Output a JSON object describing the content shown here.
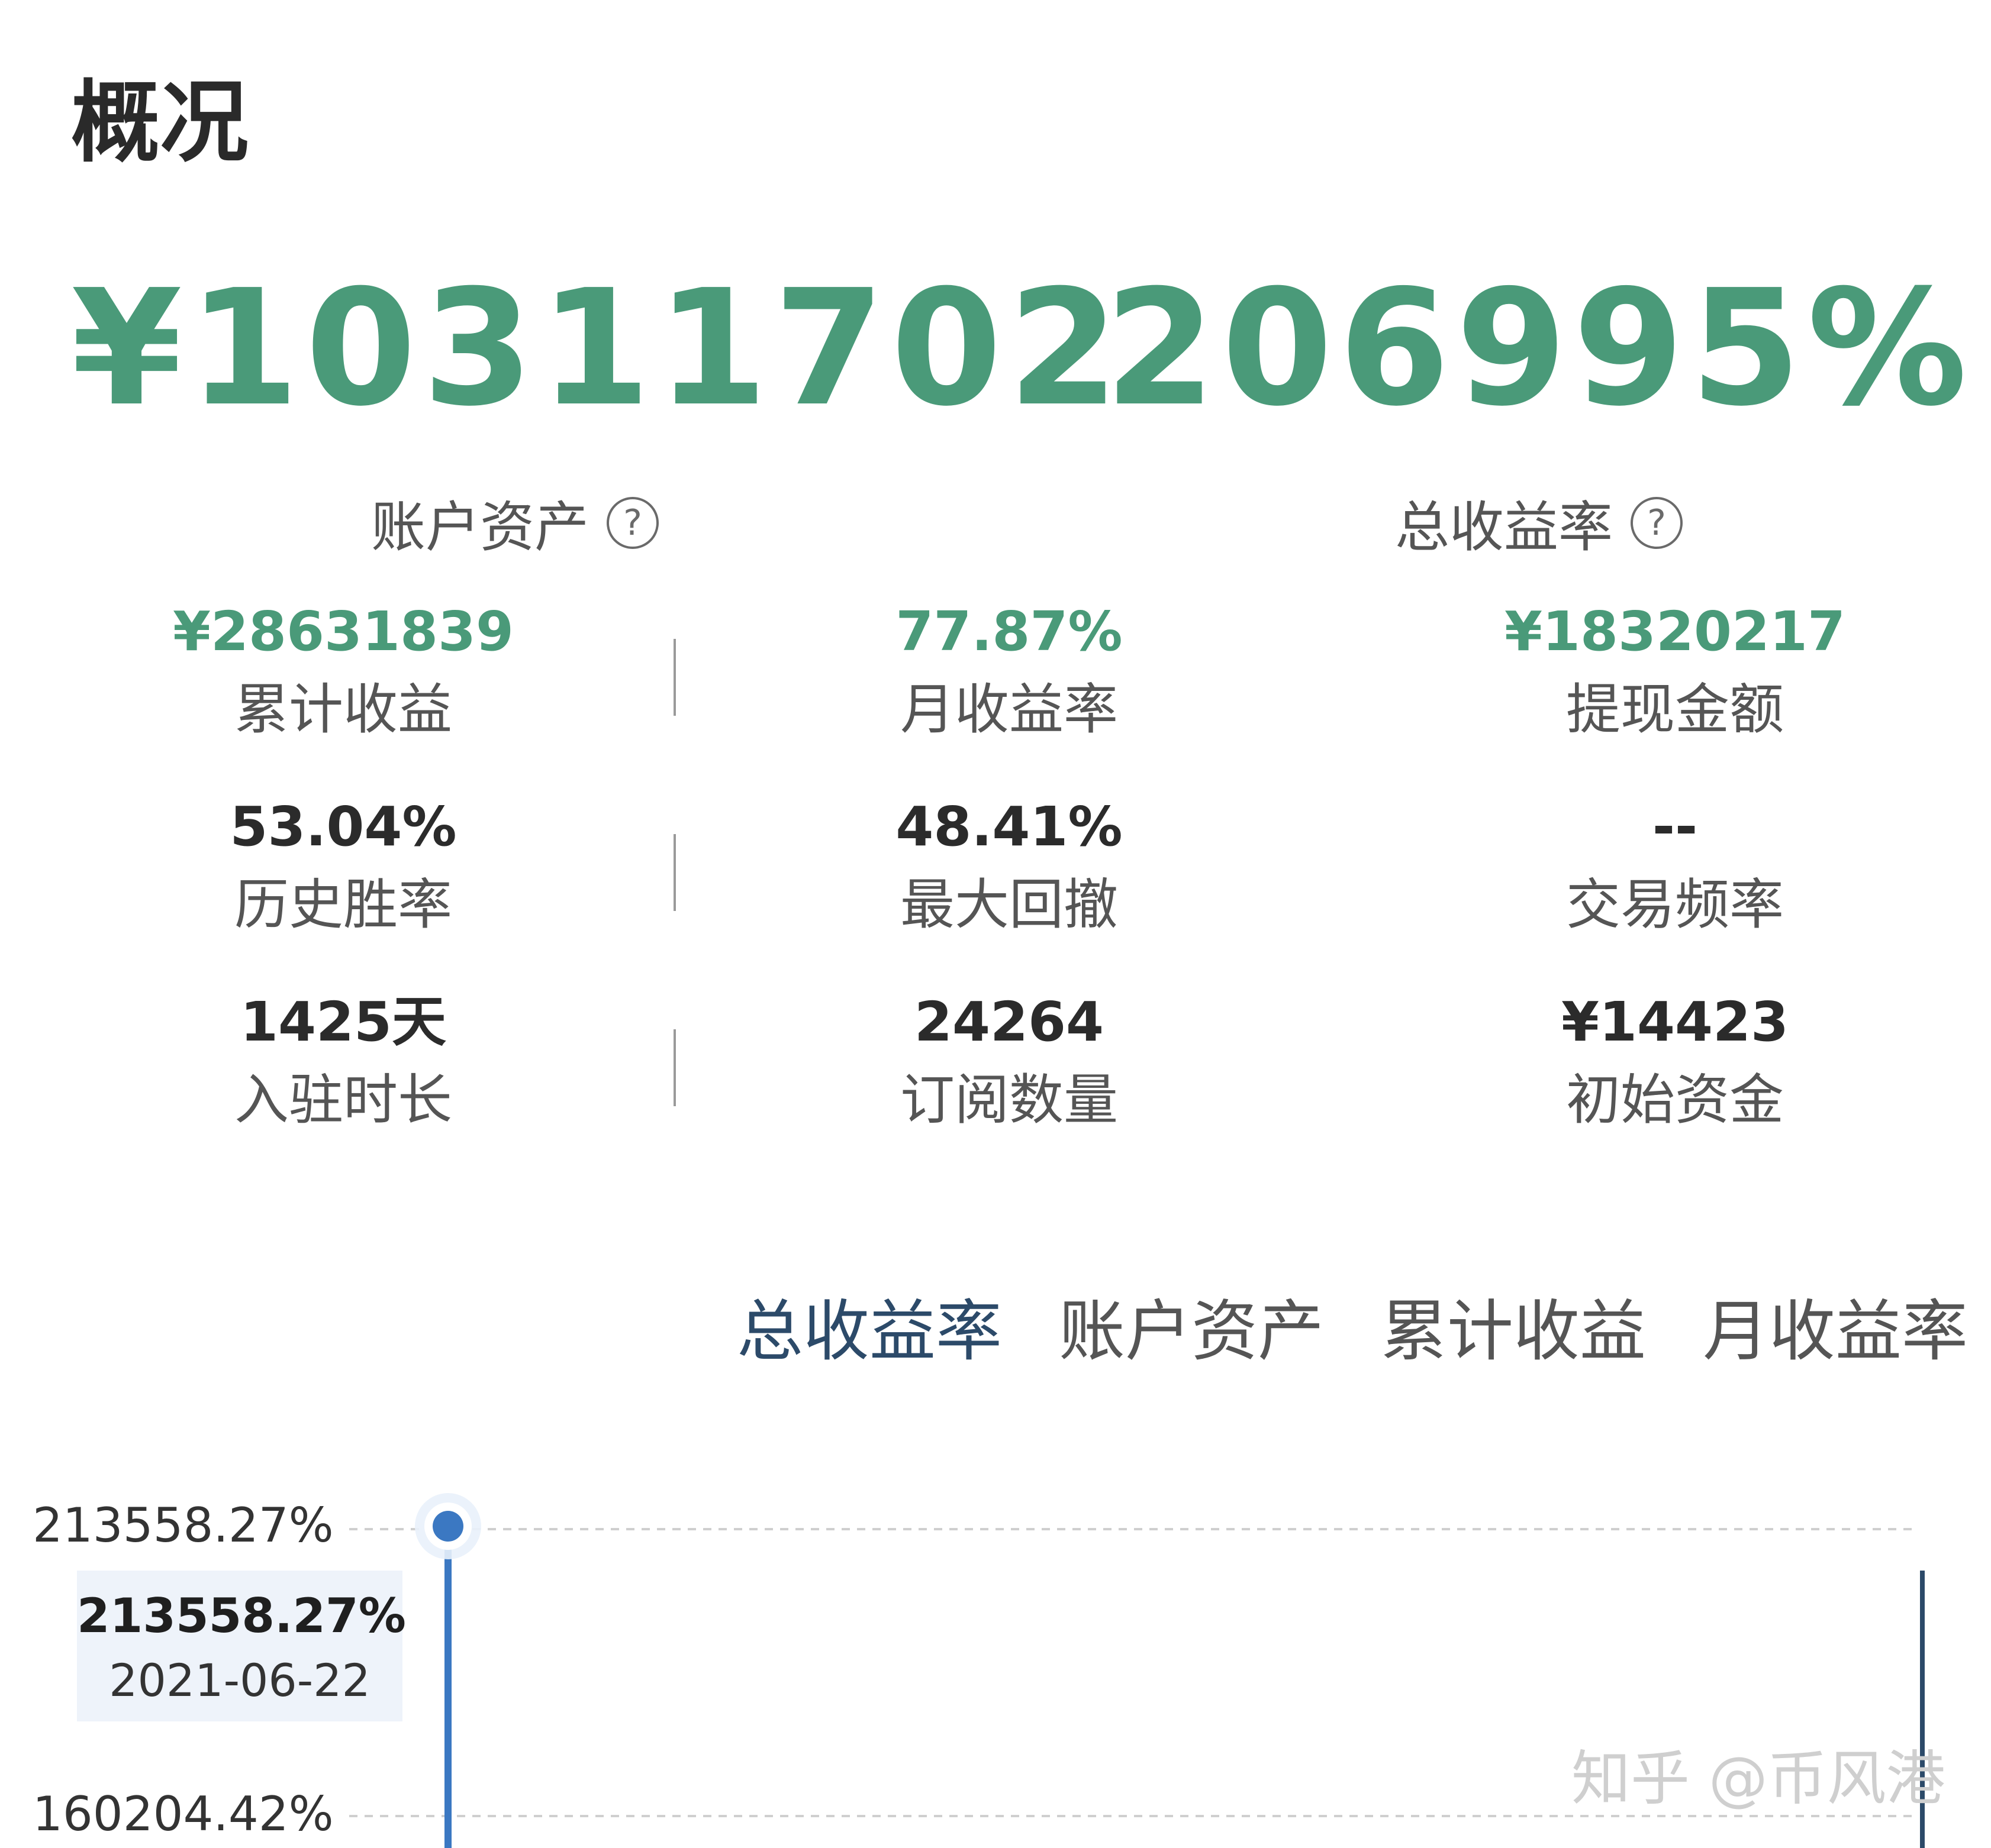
{
  "page": {
    "title": "概况"
  },
  "hero": {
    "account_assets": {
      "value": "¥10311702",
      "label": "账户资产"
    },
    "total_return": {
      "value": "206995%",
      "label": "总收益率"
    },
    "help_glyph": "?"
  },
  "stats": {
    "cumulative_profit": {
      "value": "¥28631839",
      "label": "累计收益"
    },
    "monthly_return": {
      "value": "77.87%",
      "label": "月收益率"
    },
    "withdrawal_amount": {
      "value": "¥18320217",
      "label": "提现金额"
    },
    "win_rate": {
      "value": "53.04%",
      "label": "历史胜率"
    },
    "max_drawdown": {
      "value": "48.41%",
      "label": "最大回撤"
    },
    "trade_frequency": {
      "value": "--",
      "label": "交易频率"
    },
    "tenure": {
      "value": "1425天",
      "label": "入驻时长"
    },
    "subscriptions": {
      "value": "24264",
      "label": "订阅数量"
    },
    "initial_capital": {
      "value": "¥14423",
      "label": "初始资金"
    }
  },
  "tabs": [
    {
      "label": "总收益率",
      "active": true
    },
    {
      "label": "账户资产",
      "active": false
    },
    {
      "label": "累计收益",
      "active": false
    },
    {
      "label": "月收益率",
      "active": false
    }
  ],
  "chart_data": {
    "type": "line",
    "y_tick_labels": [
      "213558.27%",
      "160204.42%"
    ],
    "tooltip": {
      "value": "213558.27%",
      "date": "2021-06-22"
    },
    "points": [
      {
        "x": "2021-06-22",
        "y": 213558.27
      }
    ],
    "grid": true,
    "colors": {
      "line": "#3b78c2",
      "marker": "#3b78c2",
      "tooltip_bg": "#eef3fa"
    }
  },
  "watermark": "知乎 @币风港",
  "colors": {
    "accent_green": "#4a9a79",
    "tab_active": "#2c4a69"
  }
}
